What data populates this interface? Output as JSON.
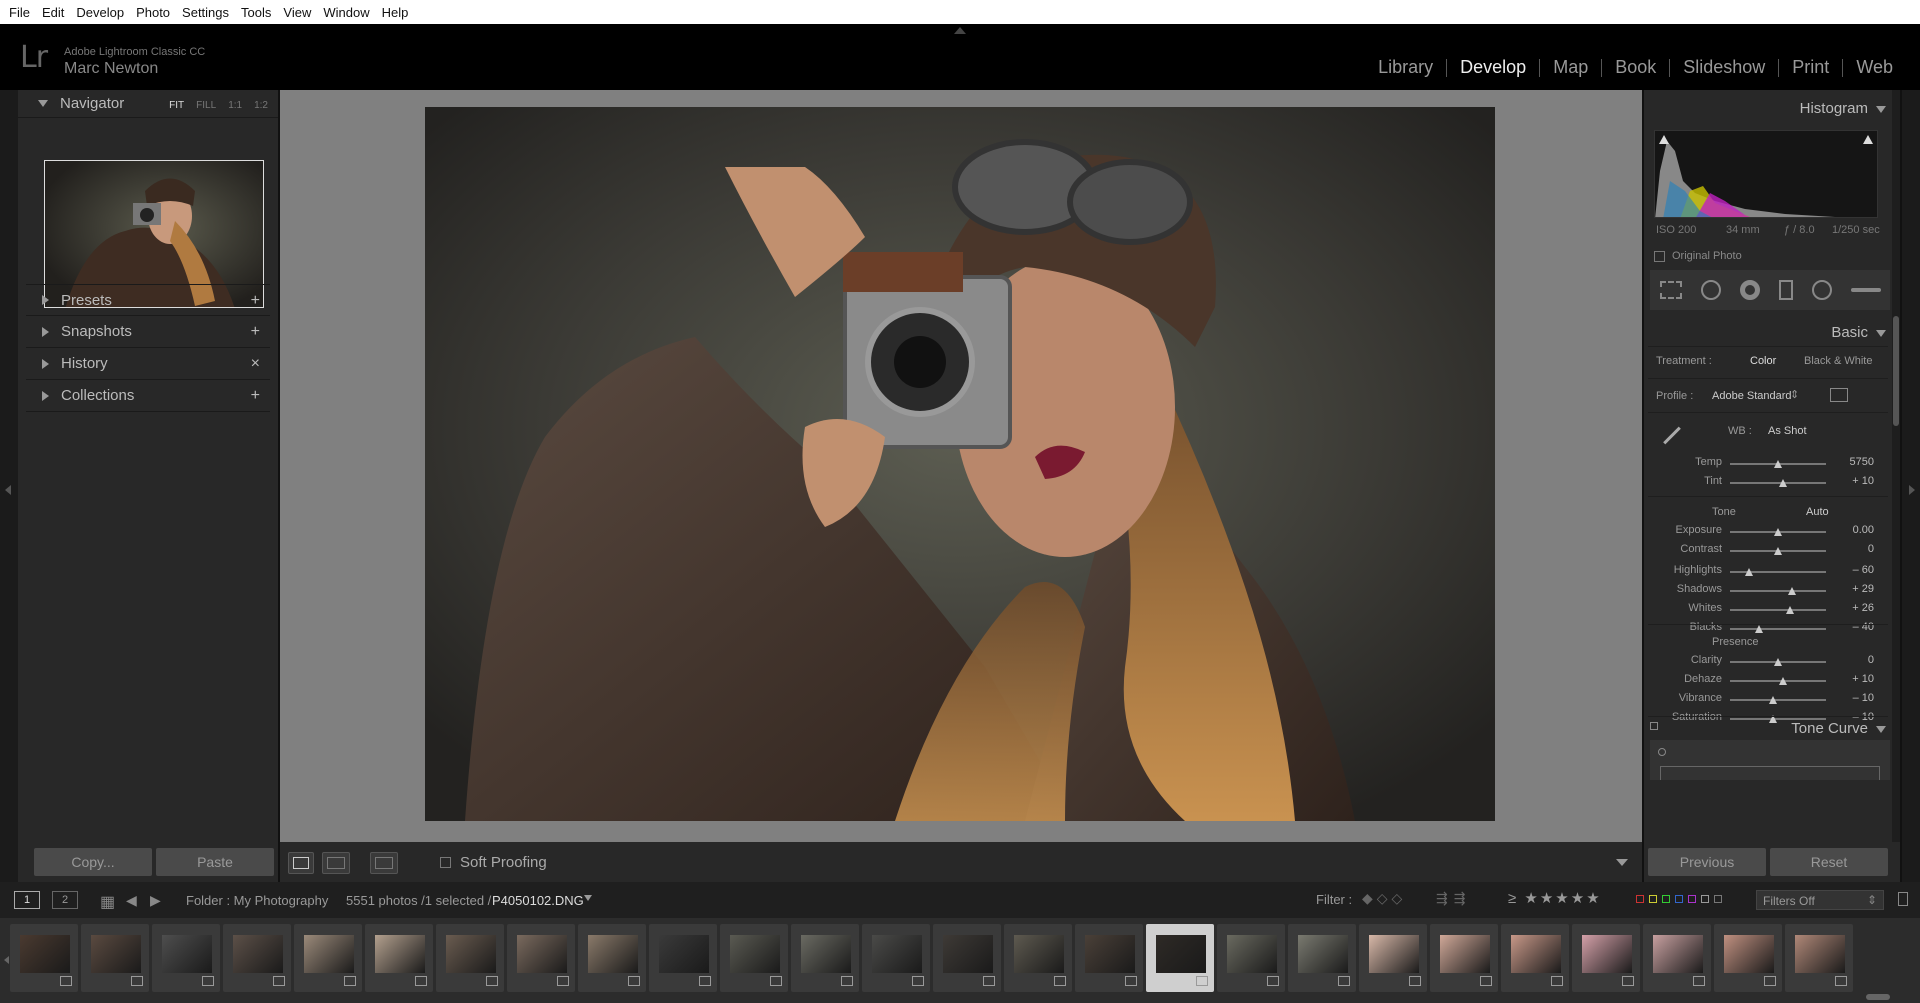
{
  "menu": [
    "File",
    "Edit",
    "Develop",
    "Photo",
    "Settings",
    "Tools",
    "View",
    "Window",
    "Help"
  ],
  "identity": {
    "logo": "Lr",
    "product": "Adobe Lightroom Classic CC",
    "user": "Marc Newton"
  },
  "modules": [
    "Library",
    "Develop",
    "Map",
    "Book",
    "Slideshow",
    "Print",
    "Web"
  ],
  "active_module": "Develop",
  "left": {
    "navigator": {
      "title": "Navigator",
      "modes": [
        "FIT",
        "FILL",
        "1:1",
        "1:2"
      ],
      "active_mode": "FIT"
    },
    "panels": [
      {
        "title": "Presets",
        "action": "+"
      },
      {
        "title": "Snapshots",
        "action": "+"
      },
      {
        "title": "History",
        "action": "×"
      },
      {
        "title": "Collections",
        "action": "+"
      }
    ],
    "copy_label": "Copy...",
    "paste_label": "Paste"
  },
  "toolbar": {
    "soft_proofing": "Soft Proofing"
  },
  "right": {
    "histogram": {
      "title": "Histogram",
      "iso": "ISO 200",
      "focal": "34 mm",
      "aperture": "ƒ / 8.0",
      "shutter": "1/250 sec",
      "original_photo": "Original Photo"
    },
    "basic": {
      "title": "Basic",
      "treatment_label": "Treatment :",
      "treatment_color": "Color",
      "treatment_bw": "Black & White",
      "profile_label": "Profile :",
      "profile_value": "Adobe Standard",
      "wb_label": "WB :",
      "wb_value": "As Shot",
      "tone_label": "Tone",
      "auto_label": "Auto",
      "presence_label": "Presence",
      "wb_sliders": [
        {
          "label": "Temp",
          "value": "5750",
          "pos": 0.5
        },
        {
          "label": "Tint",
          "value": "+ 10",
          "pos": 0.55
        }
      ],
      "tone_sliders": [
        {
          "label": "Exposure",
          "value": "0.00",
          "pos": 0.5
        },
        {
          "label": "Contrast",
          "value": "0",
          "pos": 0.5
        }
      ],
      "tone2_sliders": [
        {
          "label": "Highlights",
          "value": "– 60",
          "pos": 0.2
        },
        {
          "label": "Shadows",
          "value": "+ 29",
          "pos": 0.65
        },
        {
          "label": "Whites",
          "value": "+ 26",
          "pos": 0.63
        },
        {
          "label": "Blacks",
          "value": "– 40",
          "pos": 0.3
        }
      ],
      "presence_sliders": [
        {
          "label": "Clarity",
          "value": "0",
          "pos": 0.5
        },
        {
          "label": "Dehaze",
          "value": "+ 10",
          "pos": 0.55
        },
        {
          "label": "Vibrance",
          "value": "– 10",
          "pos": 0.45
        },
        {
          "label": "Saturation",
          "value": "– 10",
          "pos": 0.45
        }
      ]
    },
    "tone_curve": {
      "title": "Tone Curve"
    },
    "previous_label": "Previous",
    "reset_label": "Reset"
  },
  "filmbar": {
    "page1": "1",
    "page2": "2",
    "folder": "Folder : My Photography",
    "count": "5551 photos /1 selected /",
    "filename": "P4050102.DNG",
    "filter_label": "Filter :",
    "filters_off": "Filters Off"
  },
  "colors": {
    "accent": "#cfcfcf",
    "panel": "#282828",
    "bg": "#808080"
  }
}
